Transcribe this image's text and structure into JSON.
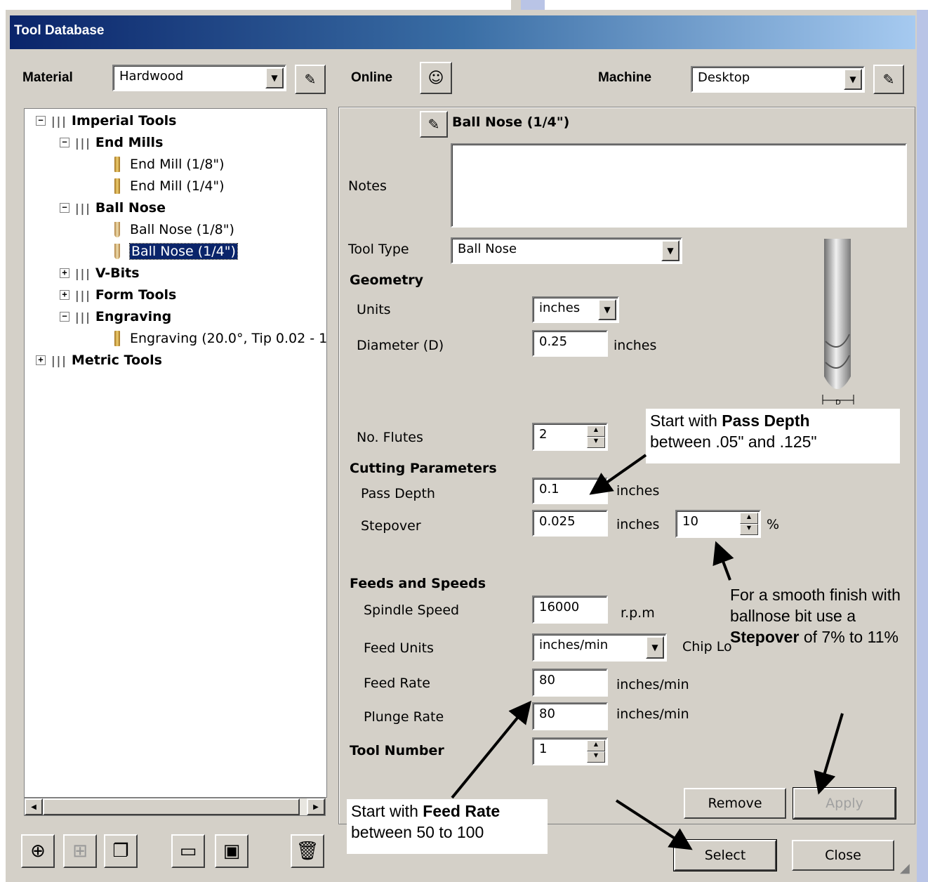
{
  "window": {
    "title": "Tool Database"
  },
  "top": {
    "material_label": "Material",
    "material_value": "Hardwood",
    "online_label": "Online",
    "machine_label": "Machine",
    "machine_value": "Desktop"
  },
  "tree": {
    "imperial": "Imperial Tools",
    "end_mills": "End Mills",
    "end_mill_1": "End Mill (1/8\")",
    "end_mill_2": "End Mill (1/4\")",
    "ball_nose": "Ball Nose",
    "ball_nose_1": "Ball Nose (1/8\")",
    "ball_nose_2": "Ball Nose (1/4\")",
    "vbits": "V-Bits",
    "form_tools": "Form Tools",
    "engraving": "Engraving",
    "engraving_1": "Engraving (20.0°, Tip 0.02 - 1",
    "metric": "Metric Tools"
  },
  "tool": {
    "name": "Ball Nose (1/4\")",
    "notes_label": "Notes",
    "notes_value": "",
    "tool_type_label": "Tool Type",
    "tool_type_value": "Ball Nose",
    "geometry_header": "Geometry",
    "units_label": "Units",
    "units_value": "inches",
    "diameter_label": "Diameter (D)",
    "diameter_value": "0.25",
    "diameter_unit": "inches",
    "flutes_label": "No. Flutes",
    "flutes_value": "2",
    "cutting_header": "Cutting Parameters",
    "pass_depth_label": "Pass Depth",
    "pass_depth_value": "0.1",
    "pass_depth_unit": "inches",
    "stepover_label": "Stepover",
    "stepover_value": "0.025",
    "stepover_unit": "inches",
    "stepover_percent": "10",
    "percent_sign": "%",
    "feeds_header": "Feeds and Speeds",
    "spindle_label": "Spindle Speed",
    "spindle_value": "16000",
    "spindle_unit": "r.p.m",
    "feed_units_label": "Feed Units",
    "feed_units_value": "inches/min",
    "chip_load_label": "Chip Lo",
    "feed_rate_label": "Feed Rate",
    "feed_rate_value": "80",
    "feed_rate_unit": "inches/min",
    "plunge_label": "Plunge Rate",
    "plunge_value": "80",
    "plunge_unit": "inches/min",
    "tool_number_label": "Tool Number",
    "tool_number_value": "1",
    "diagram_d": "D"
  },
  "buttons": {
    "remove": "Remove",
    "apply": "Apply",
    "select": "Select",
    "close": "Close"
  },
  "callouts": {
    "pass_1": "Start with ",
    "pass_bold": "Pass Depth",
    "pass_2": "between .05\" and .125\"",
    "step_1": "For a smooth finish with",
    "step_2": "ballnose bit use a",
    "step_bold": "Stepover",
    "step_3": " of 7% to 11%",
    "feed_1": "Start with ",
    "feed_bold": "Feed Rate",
    "feed_2": "between 50 to 100"
  },
  "icons": {
    "add": "add-tool-icon",
    "add_group": "add-group-icon",
    "copy": "copy-icon",
    "open": "open-folder-icon",
    "save": "save-icon",
    "delete": "delete-icon",
    "edit": "edit-icon",
    "online": "user-icon"
  }
}
